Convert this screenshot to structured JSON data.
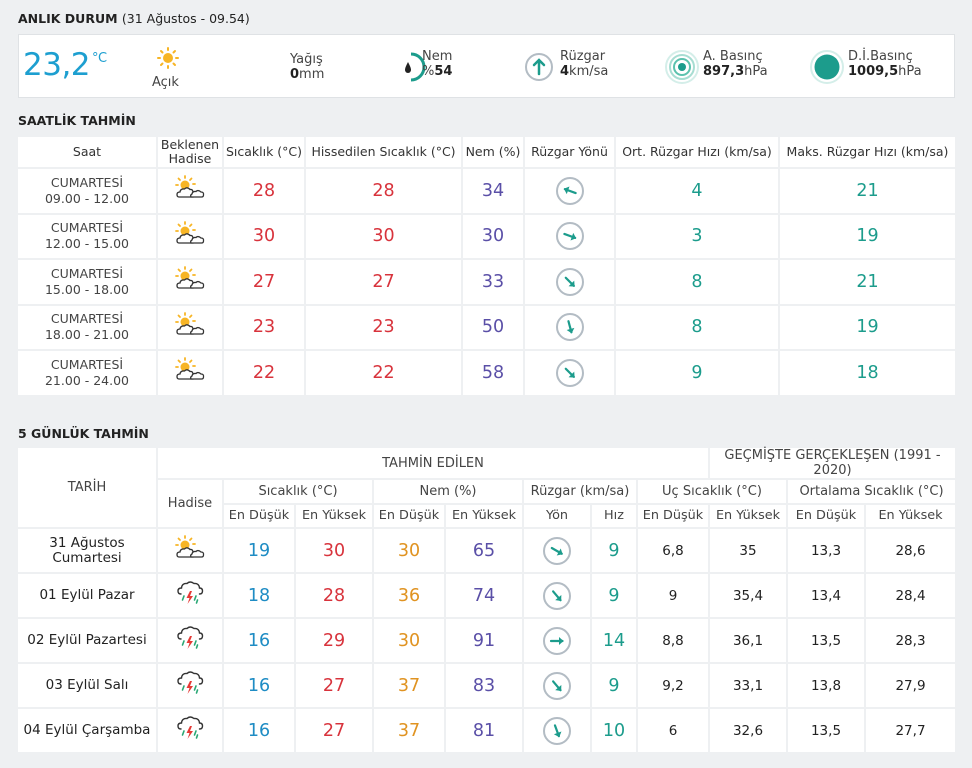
{
  "current": {
    "title": "ANLIK DURUM",
    "subtitle": "(31 Ağustos - 09.54)",
    "temperature": "23,2",
    "temperature_unit": "°C",
    "condition": "Açık",
    "rain_label": "Yağış",
    "rain_value": "0",
    "rain_unit": "mm",
    "humidity_label": "Nem",
    "humidity_prefix": "%",
    "humidity_value": "54",
    "wind_label": "Rüzgar",
    "wind_value": "4",
    "wind_unit": "km/sa",
    "pressure_label": "A. Basınç",
    "pressure_value": "897,3",
    "pressure_unit": "hPa",
    "sea_pressure_label": "D.İ.Basınç",
    "sea_pressure_value": "1009,5",
    "sea_pressure_unit": "hPa"
  },
  "hourly": {
    "title": "SAATLİK TAHMİN",
    "headers": {
      "time": "Saat",
      "event_1": "Beklenen",
      "event_2": "Hadise",
      "temp": "Sıcaklık (°C)",
      "feels": "Hissedilen Sıcaklık (°C)",
      "humidity": "Nem (%)",
      "wind_dir": "Rüzgar Yönü",
      "avg_wind": "Ort. Rüzgar Hızı (km/sa)",
      "max_wind": "Maks. Rüzgar Hızı (km/sa)"
    },
    "rows": [
      {
        "day": "CUMARTESİ",
        "range": "09.00 - 12.00",
        "icon": "partly-cloudy-icon",
        "temp": "28",
        "feels": "28",
        "humidity": "34",
        "wind_deg": 290,
        "avg": "4",
        "max": "21"
      },
      {
        "day": "CUMARTESİ",
        "range": "12.00 - 15.00",
        "icon": "partly-cloudy-icon",
        "temp": "30",
        "feels": "30",
        "humidity": "30",
        "wind_deg": 110,
        "avg": "3",
        "max": "19"
      },
      {
        "day": "CUMARTESİ",
        "range": "15.00 - 18.00",
        "icon": "partly-cloudy-icon",
        "temp": "27",
        "feels": "27",
        "humidity": "33",
        "wind_deg": 135,
        "avg": "8",
        "max": "21"
      },
      {
        "day": "CUMARTESİ",
        "range": "18.00 - 21.00",
        "icon": "partly-cloudy-icon",
        "temp": "23",
        "feels": "23",
        "humidity": "50",
        "wind_deg": 165,
        "avg": "8",
        "max": "19"
      },
      {
        "day": "CUMARTESİ",
        "range": "21.00 - 24.00",
        "icon": "partly-cloudy-icon",
        "temp": "22",
        "feels": "22",
        "humidity": "58",
        "wind_deg": 135,
        "avg": "9",
        "max": "18"
      }
    ]
  },
  "daily": {
    "title": "5 GÜNLÜK TAHMİN",
    "headers": {
      "date": "TARİH",
      "forecast": "TAHMİN EDİLEN",
      "history": "GEÇMİŞTE GERÇEKLEŞEN (1991 - 2020)",
      "event": "Hadise",
      "temp": "Sıcaklık (°C)",
      "humidity": "Nem (%)",
      "wind": "Rüzgar (km/sa)",
      "extreme": "Uç Sıcaklık (°C)",
      "average": "Ortalama Sıcaklık (°C)",
      "min": "En Düşük",
      "max": "En Yüksek",
      "dir": "Yön",
      "speed": "Hız"
    },
    "rows": [
      {
        "date_1": "31 Ağustos",
        "date_2": "Cumartesi",
        "icon": "partly-cloudy-icon",
        "tmin": "19",
        "tmax": "30",
        "hmin": "30",
        "hmax": "65",
        "wind_deg": 120,
        "speed": "9",
        "xmin": "6,8",
        "xmax": "35",
        "amin": "13,3",
        "amax": "28,6"
      },
      {
        "date_1": "01 Eylül Pazar",
        "date_2": "",
        "icon": "thunderstorm-icon",
        "tmin": "18",
        "tmax": "28",
        "hmin": "36",
        "hmax": "74",
        "wind_deg": 140,
        "speed": "9",
        "xmin": "9",
        "xmax": "35,4",
        "amin": "13,4",
        "amax": "28,4"
      },
      {
        "date_1": "02 Eylül Pazartesi",
        "date_2": "",
        "icon": "thunderstorm-icon",
        "tmin": "16",
        "tmax": "29",
        "hmin": "30",
        "hmax": "91",
        "wind_deg": 90,
        "speed": "14",
        "xmin": "8,8",
        "xmax": "36,1",
        "amin": "13,5",
        "amax": "28,3"
      },
      {
        "date_1": "03 Eylül Salı",
        "date_2": "",
        "icon": "thunderstorm-icon",
        "tmin": "16",
        "tmax": "27",
        "hmin": "37",
        "hmax": "83",
        "wind_deg": 140,
        "speed": "9",
        "xmin": "9,2",
        "xmax": "33,1",
        "amin": "13,8",
        "amax": "27,9"
      },
      {
        "date_1": "04 Eylül Çarşamba",
        "date_2": "",
        "icon": "thunderstorm-icon",
        "tmin": "16",
        "tmax": "27",
        "hmin": "37",
        "hmax": "81",
        "wind_deg": 160,
        "speed": "10",
        "xmin": "6",
        "xmax": "32,6",
        "amin": "13,5",
        "amax": "27,7"
      }
    ]
  }
}
